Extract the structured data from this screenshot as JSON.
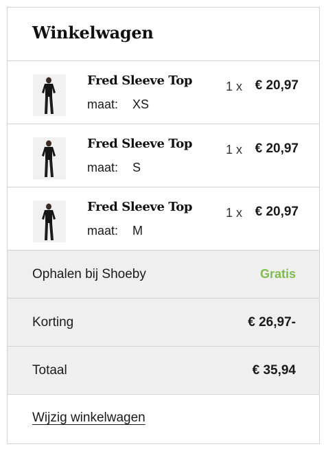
{
  "cart": {
    "title": "Winkelwagen",
    "items": [
      {
        "name": "Fred Sleeve Top",
        "size_label": "maat:",
        "size": "XS",
        "quantity": "1 x",
        "price": "€ 20,97",
        "image_icon": "product-thumbnail"
      },
      {
        "name": "Fred Sleeve Top",
        "size_label": "maat:",
        "size": "S",
        "quantity": "1 x",
        "price": "€ 20,97",
        "image_icon": "product-thumbnail"
      },
      {
        "name": "Fred Sleeve Top",
        "size_label": "maat:",
        "size": "M",
        "quantity": "1 x",
        "price": "€ 20,97",
        "image_icon": "product-thumbnail"
      }
    ],
    "shipping": {
      "label": "Ophalen bij Shoeby",
      "value": "Gratis",
      "color": "#7dbd4c"
    },
    "discount": {
      "label": "Korting",
      "value": "€ 26,97-"
    },
    "total": {
      "label": "Totaal",
      "value": "€ 35,94"
    },
    "edit_link": "Wijzig winkelwagen"
  }
}
